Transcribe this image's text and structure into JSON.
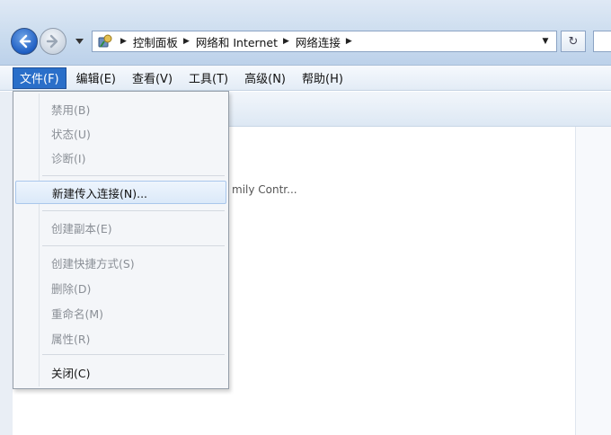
{
  "address_bar": {
    "breadcrumbs": [
      "控制面板",
      "网络和 Internet",
      "网络连接"
    ],
    "dropdown_glyph": "▼",
    "refresh_glyph": "↻"
  },
  "menubar": {
    "items": [
      {
        "label": "文件(F)",
        "active": true
      },
      {
        "label": "编辑(E)",
        "active": false
      },
      {
        "label": "查看(V)",
        "active": false
      },
      {
        "label": "工具(T)",
        "active": false
      },
      {
        "label": "高级(N)",
        "active": false
      },
      {
        "label": "帮助(H)",
        "active": false
      }
    ]
  },
  "file_menu": {
    "items": [
      {
        "label": "禁用(B)",
        "enabled": false
      },
      {
        "label": "状态(U)",
        "enabled": false
      },
      {
        "label": "诊断(I)",
        "enabled": false
      },
      {
        "label": "新建传入连接(N)...",
        "enabled": true,
        "highlighted": true
      },
      {
        "label": "创建副本(E)",
        "enabled": false
      },
      {
        "label": "创建快捷方式(S)",
        "enabled": false
      },
      {
        "label": "删除(D)",
        "enabled": false
      },
      {
        "label": "重命名(M)",
        "enabled": false
      },
      {
        "label": "属性(R)",
        "enabled": false
      },
      {
        "label": "关闭(C)",
        "enabled": true
      }
    ]
  },
  "content": {
    "partial_item_text": "mily Contr..."
  },
  "colors": {
    "menu_active_bg": "#2a6fc9",
    "menu_highlight_border": "#a9c7ec",
    "disabled_text": "#8a8f96"
  }
}
